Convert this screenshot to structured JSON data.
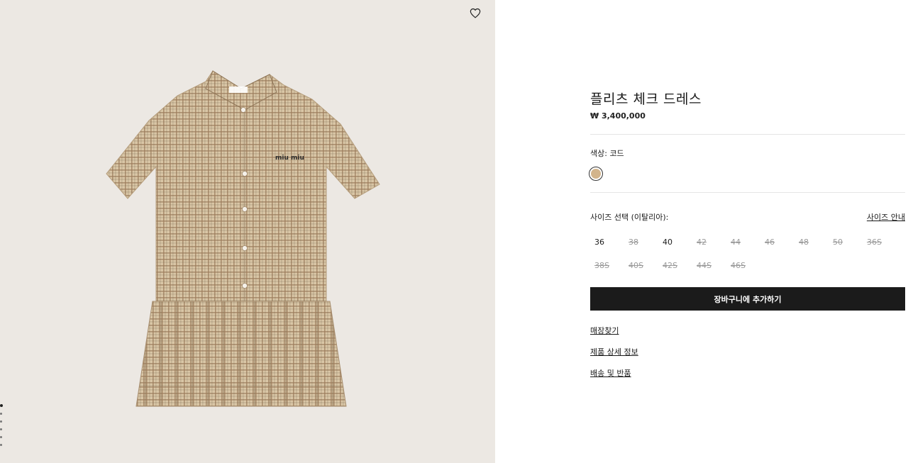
{
  "product": {
    "title": "플리츠 체크 드레스",
    "price": "₩ 3,400,000"
  },
  "color": {
    "label": "색상: 코드",
    "swatch_hex": "#d2b48c"
  },
  "sizes": {
    "label": "사이즈 선택 (이탈리아):",
    "guide_label": "사이즈 안내",
    "row1": [
      {
        "label": "36",
        "available": true
      },
      {
        "label": "38",
        "available": false
      },
      {
        "label": "40",
        "available": true
      },
      {
        "label": "42",
        "available": false
      },
      {
        "label": "44",
        "available": false
      },
      {
        "label": "46",
        "available": false
      },
      {
        "label": "48",
        "available": false
      },
      {
        "label": "50",
        "available": false
      },
      {
        "label": "36S",
        "available": false
      }
    ],
    "row2": [
      {
        "label": "38S",
        "available": false
      },
      {
        "label": "40S",
        "available": false
      },
      {
        "label": "42S",
        "available": false
      },
      {
        "label": "44S",
        "available": false
      },
      {
        "label": "46S",
        "available": false
      }
    ]
  },
  "actions": {
    "add_to_cart": "장바구니에 추가하기"
  },
  "links": {
    "store_finder": "매장찾기",
    "product_details": "제품 상세 정보",
    "shipping_returns": "배송 및 반품"
  },
  "image": {
    "logo_text": "miu miu"
  },
  "icons": {
    "favorite": "heart-outline-icon"
  }
}
